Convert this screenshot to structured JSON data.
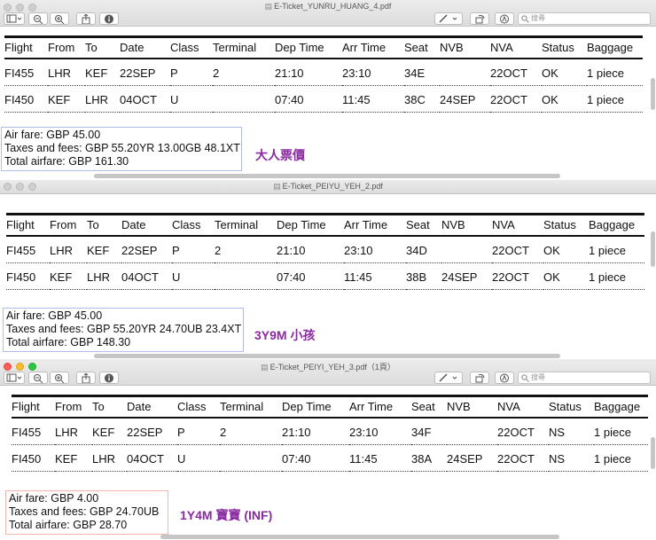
{
  "colors": {
    "note": "#8a2aa0",
    "box_blue": "#b0bde8",
    "box_red": "#f2b5a9"
  },
  "toolbar": {
    "icons": [
      "sidebar-icon",
      "zoom-out-icon",
      "zoom-in-icon",
      "share-icon",
      "info-icon",
      "markup-pen-icon",
      "rotate-icon",
      "annotate-icon",
      "search-icon"
    ],
    "search_placeholder": "搜尋"
  },
  "columns": [
    "Flight",
    "From",
    "To",
    "Date",
    "Class",
    "Terminal",
    "Dep Time",
    "Arr Time",
    "Seat",
    "NVB",
    "NVA",
    "Status",
    "Baggage"
  ],
  "windows": [
    {
      "title": "E-Ticket_YUNRU_HUANG_4.pdf",
      "rows": [
        [
          "FI455",
          "LHR",
          "KEF",
          "22SEP",
          "P",
          "2",
          "21:10",
          "23:10",
          "34E",
          "",
          "22OCT",
          "OK",
          "1 piece"
        ],
        [
          "FI450",
          "KEF",
          "LHR",
          "04OCT",
          "U",
          "",
          "07:40",
          "11:45",
          "38C",
          "24SEP",
          "22OCT",
          "OK",
          "1 piece"
        ]
      ],
      "fare": [
        "Air fare: GBP 45.00",
        "Taxes and fees: GBP 55.20YR 13.00GB 48.1XT",
        "Total airfare: GBP 161.30"
      ],
      "note": "大人票價"
    },
    {
      "title": "E-Ticket_PEIYU_YEH_2.pdf",
      "rows": [
        [
          "FI455",
          "LHR",
          "KEF",
          "22SEP",
          "P",
          "2",
          "21:10",
          "23:10",
          "34D",
          "",
          "22OCT",
          "OK",
          "1 piece"
        ],
        [
          "FI450",
          "KEF",
          "LHR",
          "04OCT",
          "U",
          "",
          "07:40",
          "11:45",
          "38B",
          "24SEP",
          "22OCT",
          "OK",
          "1 piece"
        ]
      ],
      "fare": [
        "Air fare: GBP 45.00",
        "Taxes and fees: GBP 55.20YR 24.70UB 23.4XT",
        "Total airfare: GBP 148.30"
      ],
      "note": "3Y9M 小孩"
    },
    {
      "title": "E-Ticket_PEIYI_YEH_3.pdf（1頁）",
      "rows": [
        [
          "FI455",
          "LHR",
          "KEF",
          "22SEP",
          "P",
          "2",
          "21:10",
          "23:10",
          "34F",
          "",
          "22OCT",
          "NS",
          "1 piece"
        ],
        [
          "FI450",
          "KEF",
          "LHR",
          "04OCT",
          "U",
          "",
          "07:40",
          "11:45",
          "38A",
          "24SEP",
          "22OCT",
          "NS",
          "1 piece"
        ]
      ],
      "fare": [
        "Air fare: GBP 4.00",
        "Taxes and fees: GBP 24.70UB",
        "Total airfare: GBP 28.70"
      ],
      "note": "1Y4M 寶寶 (INF)"
    }
  ]
}
